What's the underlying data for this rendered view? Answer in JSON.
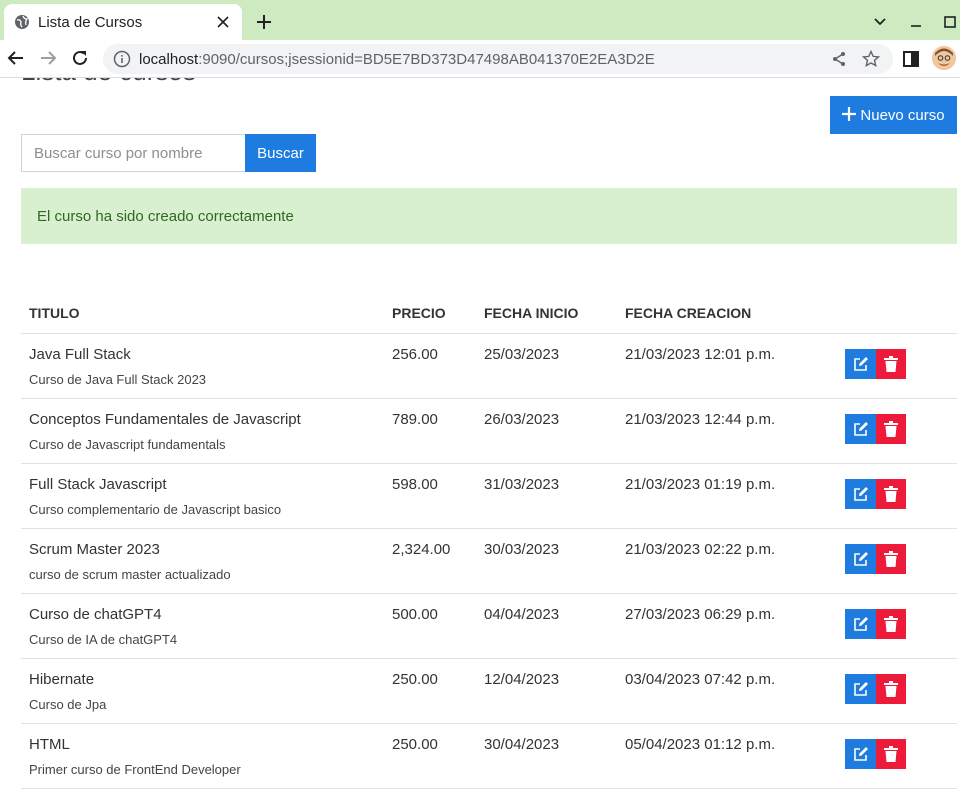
{
  "browser": {
    "tab_title": "Lista de Cursos",
    "url_host": "localhost",
    "url_rest": ":9090/cursos;jsessionid=BD5E7BD373D47498AB041370E2EA3D2E"
  },
  "page": {
    "title": "Lista de cursos",
    "new_button": "Nuevo curso",
    "search_placeholder": "Buscar curso por nombre",
    "search_button": "Buscar",
    "alert": "El curso ha sido creado correctamente"
  },
  "table": {
    "headers": [
      "TITULO",
      "PRECIO",
      "FECHA INICIO",
      "FECHA CREACION"
    ],
    "rows": [
      {
        "title": "Java Full Stack",
        "desc": "Curso de Java Full Stack 2023",
        "price": "256.00",
        "start": "25/03/2023",
        "created": "21/03/2023 12:01 p.m."
      },
      {
        "title": "Conceptos Fundamentales de Javascript",
        "desc": "Curso de Javascript fundamentals",
        "price": "789.00",
        "start": "26/03/2023",
        "created": "21/03/2023 12:44 p.m."
      },
      {
        "title": "Full Stack Javascript",
        "desc": "Curso complementario de Javascript basico",
        "price": "598.00",
        "start": "31/03/2023",
        "created": "21/03/2023 01:19 p.m."
      },
      {
        "title": "Scrum Master 2023",
        "desc": "curso de scrum master actualizado",
        "price": "2,324.00",
        "start": "30/03/2023",
        "created": "21/03/2023 02:22 p.m."
      },
      {
        "title": "Curso de chatGPT4",
        "desc": "Curso de IA de chatGPT4",
        "price": "500.00",
        "start": "04/04/2023",
        "created": "27/03/2023 06:29 p.m."
      },
      {
        "title": "Hibernate",
        "desc": "Curso de Jpa",
        "price": "250.00",
        "start": "12/04/2023",
        "created": "03/04/2023 07:42 p.m."
      },
      {
        "title": "HTML",
        "desc": "Primer curso de FrontEnd Developer",
        "price": "250.00",
        "start": "30/04/2023",
        "created": "05/04/2023 01:12 p.m."
      }
    ]
  },
  "colors": {
    "primary": "#1e7be0",
    "danger": "#ee1a3a",
    "alert_bg": "#d8efd0",
    "alert_text": "#2d6a1f",
    "tabbar_bg": "#cdeac0"
  },
  "icons": {
    "edit": "edit-icon",
    "delete": "trash-icon",
    "plus": "plus-icon",
    "favicon": "globe-icon"
  }
}
